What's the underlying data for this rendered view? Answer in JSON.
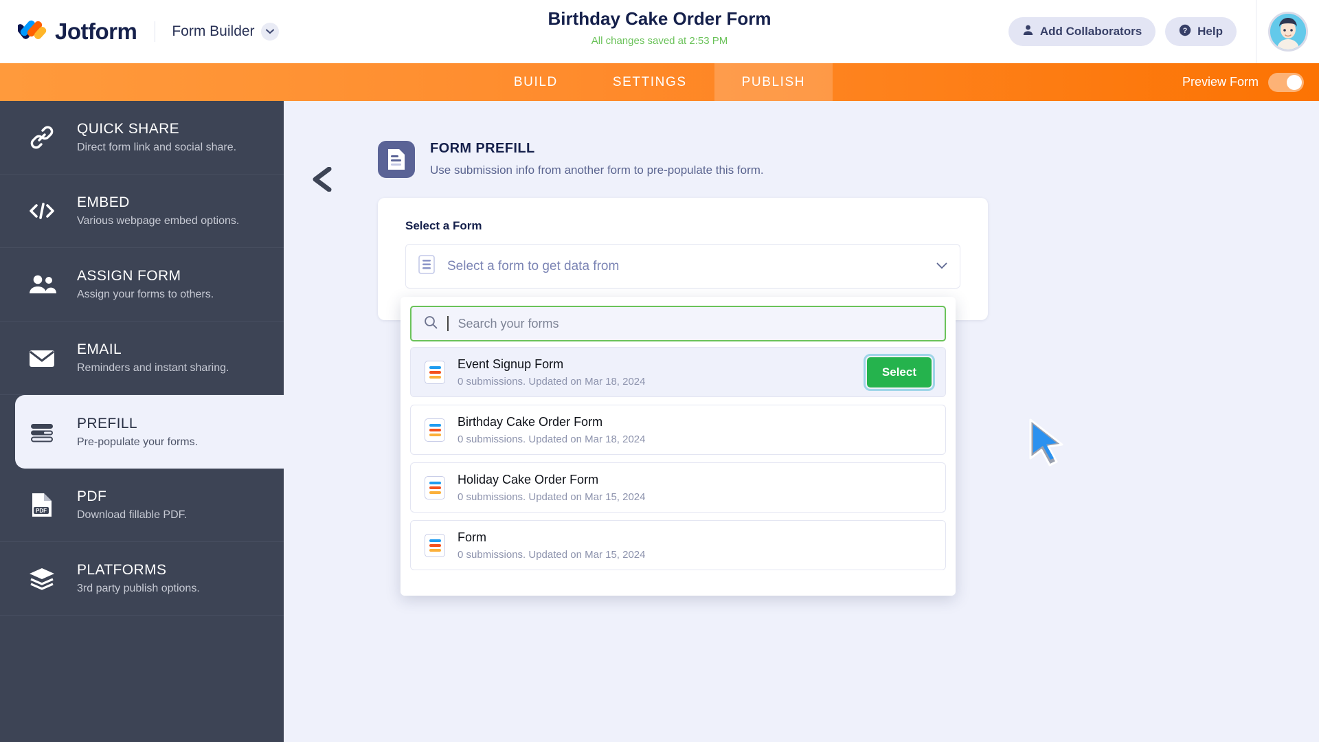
{
  "header": {
    "brand": "Jotform",
    "logo_icon": "jotform-logo-icon",
    "form_builder_label": "Form Builder",
    "chevron_icon": "chevron-down-icon",
    "doc_title": "Birthday Cake Order Form",
    "saved_note": "All changes saved at 2:53 PM",
    "add_collaborators_label": "Add Collaborators",
    "add_collaborators_icon": "user-icon",
    "help_label": "Help",
    "help_icon": "question-circle-icon",
    "avatar_icon": "avatar"
  },
  "nav": {
    "tabs": [
      {
        "label": "BUILD",
        "active": false
      },
      {
        "label": "SETTINGS",
        "active": false
      },
      {
        "label": "PUBLISH",
        "active": true
      }
    ],
    "preview_label": "Preview Form",
    "toggle_state": "off"
  },
  "sidebar": {
    "items": [
      {
        "title": "QUICK SHARE",
        "sub": "Direct form link and social share.",
        "icon": "link-icon",
        "active": false
      },
      {
        "title": "EMBED",
        "sub": "Various webpage embed options.",
        "icon": "code-icon",
        "active": false
      },
      {
        "title": "ASSIGN FORM",
        "sub": "Assign your forms to others.",
        "icon": "people-icon",
        "active": false
      },
      {
        "title": "EMAIL",
        "sub": "Reminders and instant sharing.",
        "icon": "envelope-icon",
        "active": false
      },
      {
        "title": "PREFILL",
        "sub": "Pre-populate your forms.",
        "icon": "prefill-bars-icon",
        "active": true
      },
      {
        "title": "PDF",
        "sub": "Download fillable PDF.",
        "icon": "pdf-icon",
        "active": false
      },
      {
        "title": "PLATFORMS",
        "sub": "3rd party publish options.",
        "icon": "layers-icon",
        "active": false
      }
    ]
  },
  "main": {
    "back_icon": "back-arrow-icon",
    "panel_icon": "form-prefill-icon",
    "title": "FORM PREFILL",
    "subtitle": "Use submission info from another form to pre-populate this form.",
    "card": {
      "label": "Select a Form",
      "select_icon": "form-lines-icon",
      "select_placeholder": "Select a form to get data from",
      "chevron_icon": "chevron-down-icon"
    },
    "dropdown": {
      "search_icon": "search-icon",
      "search_value": "",
      "search_placeholder": "Search your forms",
      "select_button_label": "Select",
      "cursor_icon": "mouse-cursor-icon",
      "items": [
        {
          "name": "Event Signup Form",
          "meta": "0 submissions. Updated on Mar 18, 2024",
          "icon": "form-icon",
          "hovered": true
        },
        {
          "name": "Birthday Cake Order Form",
          "meta": "0 submissions. Updated on Mar 18, 2024",
          "icon": "form-icon",
          "hovered": false
        },
        {
          "name": "Holiday Cake Order Form",
          "meta": "0 submissions. Updated on Mar 15, 2024",
          "icon": "form-icon",
          "hovered": false
        },
        {
          "name": "Form",
          "meta": "0 submissions. Updated on Mar 15, 2024",
          "icon": "form-icon",
          "hovered": false
        }
      ]
    }
  },
  "colors": {
    "brand_navy": "#15204b",
    "orange": "#fc7303",
    "green": "#6ac259",
    "select_green": "#25b34d",
    "sidebar": "#3d4455",
    "canvas": "#eff1fb"
  }
}
